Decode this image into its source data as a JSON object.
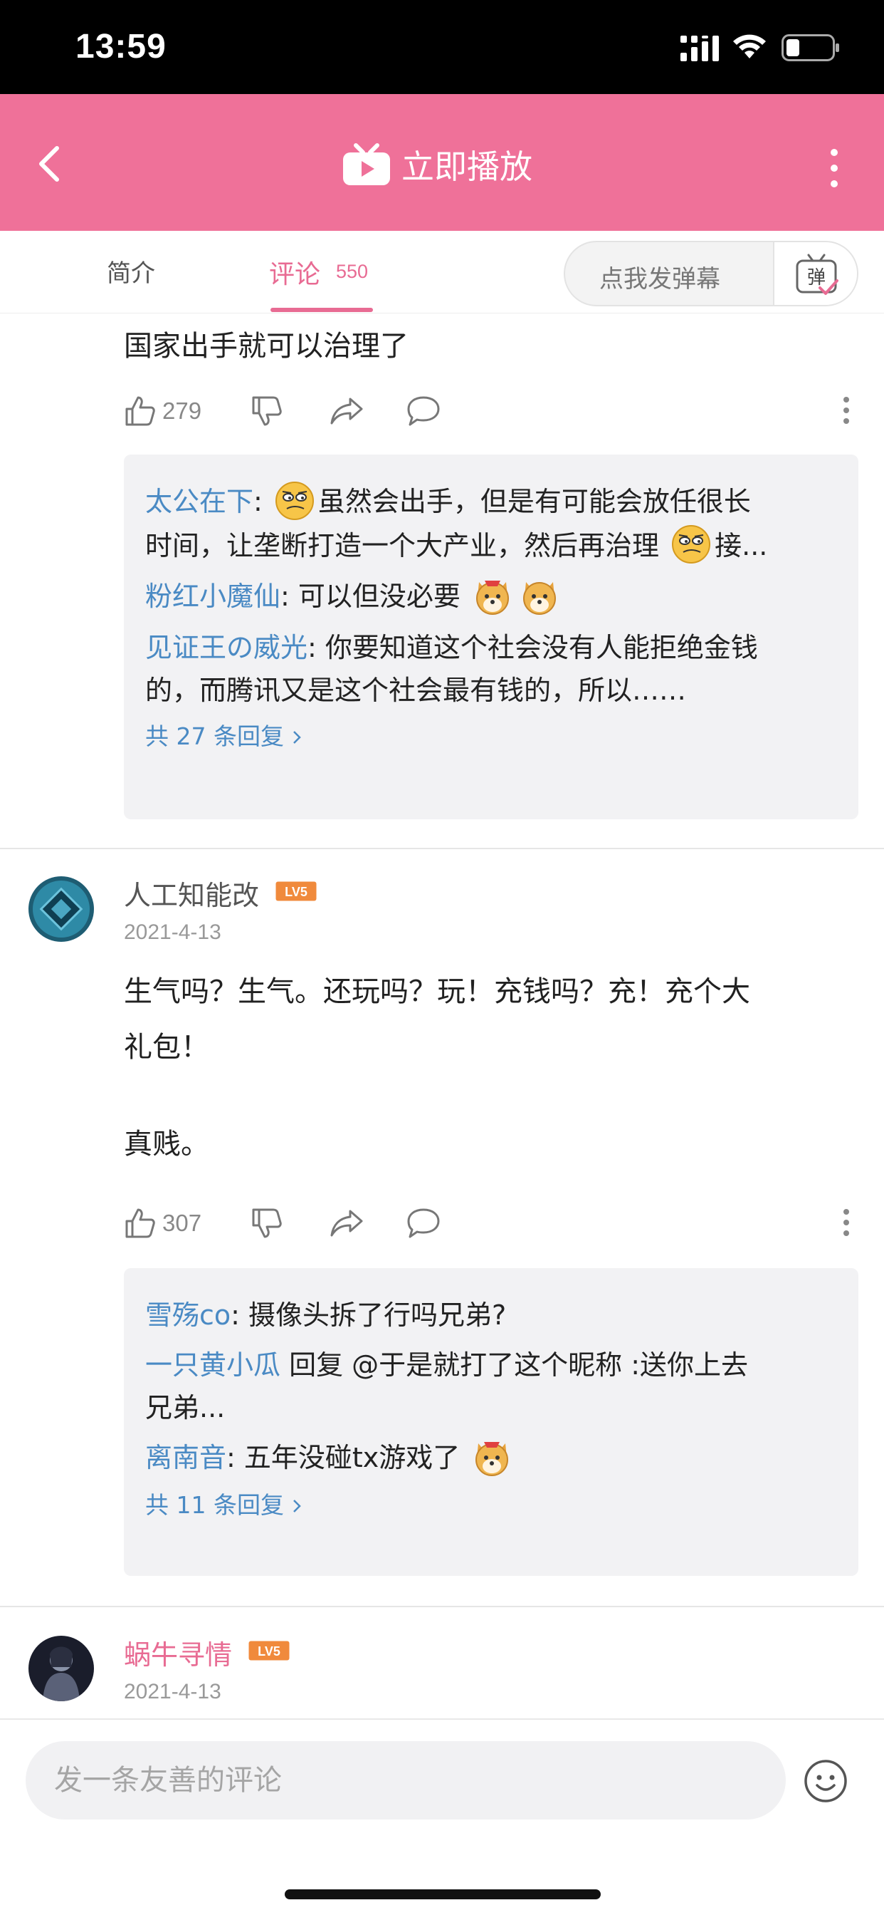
{
  "status_bar": {
    "time": "13:59"
  },
  "nav": {
    "title": "立即播放"
  },
  "tabs": {
    "intro_label": "简介",
    "comment_label": "评论",
    "comment_count": "550",
    "danmu_placeholder": "点我发弹幕",
    "danmu_btn_label": "弹"
  },
  "comments": [
    {
      "text": "国家出手就可以治理了",
      "likes": "279",
      "replies": [
        {
          "user": "太公在下",
          "sep": ": ",
          "text_a": "虽然会出手，但是有可能会放任很长",
          "text_b": "时间，让垄断打造一个大产业，然后再治理",
          "text_c": "接..."
        },
        {
          "user": "粉红小魔仙",
          "sep": ": ",
          "text": "可以但没必要"
        },
        {
          "user": "见证王の威光",
          "sep": ": ",
          "text_a": "你要知道这个社会没有人能拒绝金钱",
          "text_b": "的，而腾讯又是这个社会最有钱的，所以……"
        }
      ],
      "more_replies": "共 27 条回复"
    },
    {
      "user": "人工知能改",
      "level": "LV5",
      "date": "2021-4-13",
      "text_1": "生气吗？生气。还玩吗？玩！充钱吗？充！充个大",
      "text_2": "礼包！",
      "text_3": "真贱。",
      "likes": "307",
      "replies": [
        {
          "user": "雪殇co",
          "sep": ": ",
          "text": "摄像头拆了行吗兄弟?"
        },
        {
          "user": "一只黄小瓜",
          "text_a": " 回复 @于是就打了这个昵称 :送你上去",
          "text_b": "兄弟..."
        },
        {
          "user": "离南音",
          "sep": ": ",
          "text": "五年没碰tx游戏了"
        }
      ],
      "more_replies": "共 11 条回复"
    },
    {
      "user": "蜗牛寻情",
      "level": "LV5",
      "date": "2021-4-13"
    }
  ],
  "bottom": {
    "input_placeholder": "发一条友善的评论"
  },
  "colors": {
    "brand_pink": "#ef7199",
    "link_blue": "#4a8ac4",
    "level_orange": "#f08a3c"
  }
}
